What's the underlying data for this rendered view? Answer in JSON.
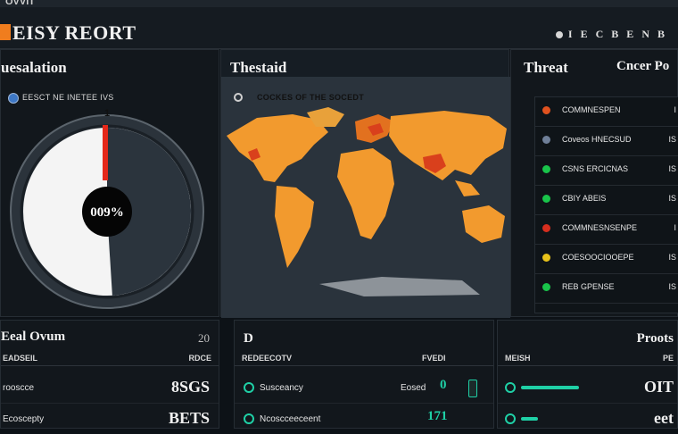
{
  "window": {
    "title_strip": "OVVIT"
  },
  "header": {
    "title": "EISY REORT",
    "controls": [
      "I",
      "E",
      "C",
      "B",
      "E",
      "N",
      "B"
    ],
    "accent": "#f07d1e"
  },
  "left_panel": {
    "title": "uesalation",
    "legend_label": "EESCT NE INETEE IVS",
    "gauge_marker": "1",
    "gauge_center": "009%",
    "gauge_value_fraction": 0.49
  },
  "map_panel": {
    "title": "Thestaid",
    "legend_label": "COCKES OF THE SOCEDT",
    "land_color": "#f29a2e",
    "hotspot_color": "#d9401c"
  },
  "right_panel": {
    "title_left": "Threat",
    "title_right": "Cncer Po",
    "rows": [
      {
        "dot": "#e0521f",
        "label": "COMMNESPEN",
        "value": "I"
      },
      {
        "dot": "#6f7f98",
        "label": "Coveos HNECSUD",
        "value": "IS"
      },
      {
        "dot": "#19c44a",
        "label": "CSNS ERCICNAS",
        "value": "IS"
      },
      {
        "dot": "#19c44a",
        "label": "CBIY ABEIS",
        "value": "IS"
      },
      {
        "dot": "#d62e1e",
        "label": "COMMNESNSENPE",
        "value": "I"
      },
      {
        "dot": "#e8c21a",
        "label": "COESOOCIOOEPE",
        "value": "IS"
      },
      {
        "dot": "#19c44a",
        "label": "REB GPENSE",
        "value": "IS"
      }
    ]
  },
  "bottom_left": {
    "title": "Eeal Ovum",
    "count": "20",
    "col1": "EADSEIL",
    "col2": "RDCE",
    "rows": [
      {
        "label": "rooscce",
        "value": "8SGS"
      },
      {
        "label": "Ecoscepty",
        "value": "BETS"
      }
    ]
  },
  "bottom_mid": {
    "title": "D",
    "col1": "REDEECOTV",
    "col2": "FVEDI",
    "rows": [
      {
        "label": "Susceancy",
        "value": "Eosed",
        "indicator": "0"
      },
      {
        "label": "Ncoscceeceent",
        "value": "171",
        "indicator": ""
      }
    ]
  },
  "bottom_right": {
    "title": "Proots",
    "col1": "MEISH",
    "col2": "PE",
    "rows": [
      {
        "value": "OIT",
        "bar_fraction": 0.68
      },
      {
        "value": "eet",
        "bar_fraction": 0.2
      }
    ]
  }
}
